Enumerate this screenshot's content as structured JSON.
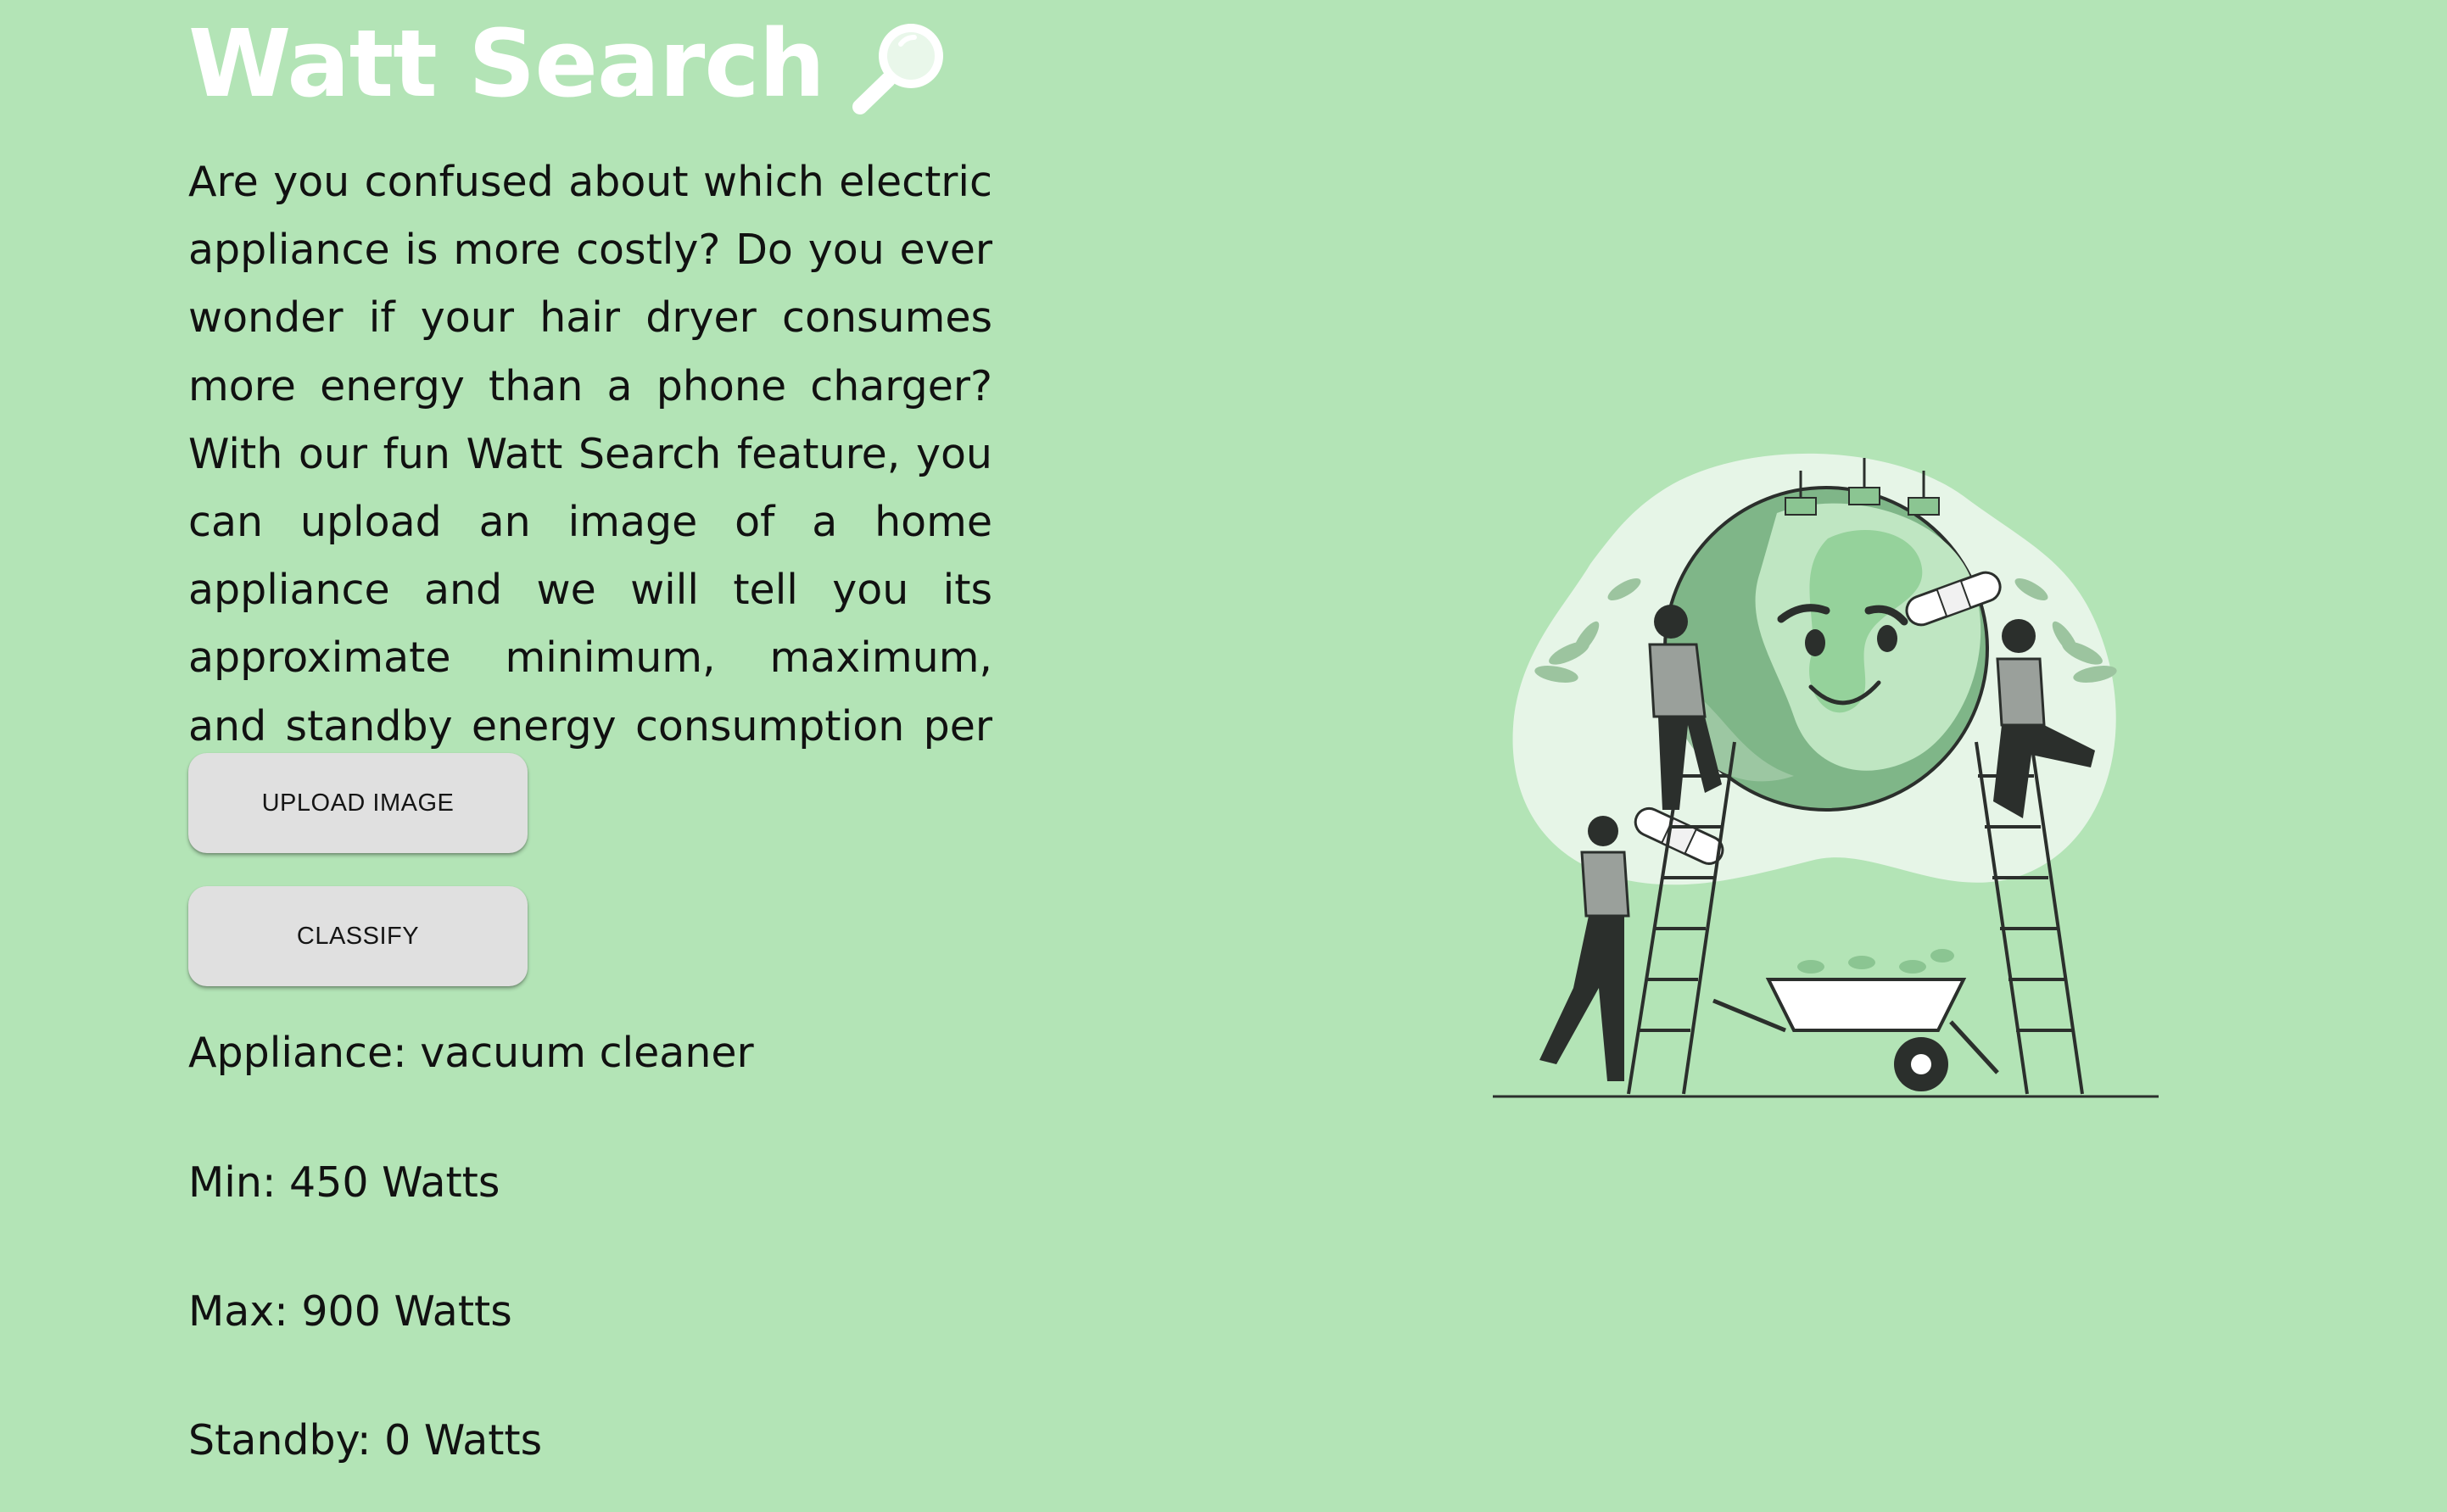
{
  "header": {
    "title": "Watt Search",
    "title_icon": "magnifying-glass-icon"
  },
  "intro": {
    "text": "Are you confused about which electric appliance is more costly? Do you ever wonder if your hair dryer consumes more energy than a phone charger? With our fun Watt Search feature, you can upload an image of a home appliance and we will tell you its approximate minimum, maximum, and standby energy consumption per hour."
  },
  "actions": {
    "upload_label": "UPLOAD IMAGE",
    "classify_label": "CLASSIFY"
  },
  "results": {
    "appliance": "Appliance: vacuum cleaner",
    "min": "Min: 450 Watts",
    "max": "Max: 900 Watts",
    "standby": "Standby: 0 Watts"
  },
  "illustration": {
    "icon": "earth-care-illustration"
  },
  "colors": {
    "background": "#b3e4b6",
    "title": "#ffffff",
    "button": "#e0e0e0",
    "text": "#111111"
  }
}
